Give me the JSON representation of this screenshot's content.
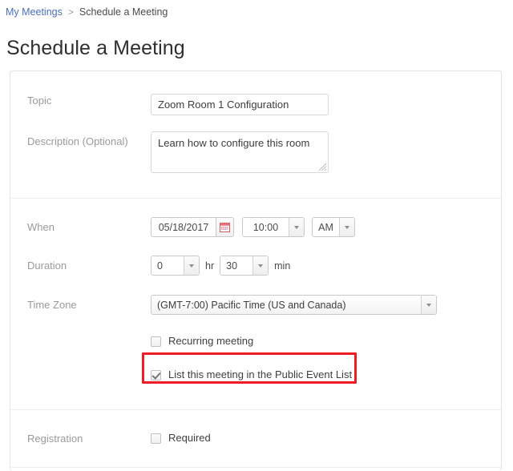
{
  "breadcrumb": {
    "parent_label": "My Meetings",
    "separator": ">",
    "current_label": "Schedule a Meeting"
  },
  "page": {
    "title": "Schedule a Meeting"
  },
  "form": {
    "topic": {
      "label": "Topic",
      "value": "Zoom Room 1 Configuration",
      "placeholder": ""
    },
    "description": {
      "label": "Description (Optional)",
      "value": "Learn how to configure this room",
      "placeholder": ""
    },
    "when": {
      "label": "When",
      "date_value": "05/18/2017",
      "calendar_icon": "calendar-icon",
      "time_value": "10:00",
      "meridiem_value": "AM"
    },
    "duration": {
      "label": "Duration",
      "hours_value": "0",
      "hours_unit": "hr",
      "minutes_value": "30",
      "minutes_unit": "min"
    },
    "timezone": {
      "label": "Time Zone",
      "value": "(GMT-7:00) Pacific Time (US and Canada)"
    },
    "recurring": {
      "label": "Recurring meeting",
      "checked": false
    },
    "public_event": {
      "label": "List this meeting in the Public Event List",
      "checked": true
    },
    "registration": {
      "label": "Registration",
      "required_label": "Required",
      "checked": false
    }
  },
  "annotation": {
    "highlight_color": "#ee1c24",
    "target": "public-event-list-checkbox-row"
  },
  "colors": {
    "link": "#4a6fb5",
    "label": "#9a9a9a",
    "text": "#3d3d3d",
    "panel_border": "#e3e3e3",
    "divider": "#ececec"
  }
}
